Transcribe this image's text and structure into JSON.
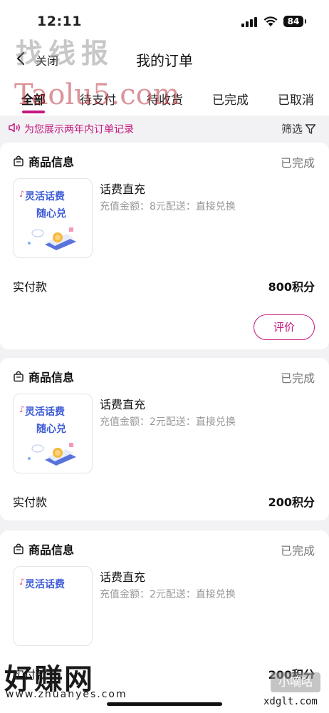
{
  "status_bar": {
    "time": "12:11",
    "battery": "84"
  },
  "nav": {
    "close_label": "关闭",
    "title": "我的订单"
  },
  "tabs": [
    {
      "label": "全部",
      "active": true
    },
    {
      "label": "待支付",
      "active": false
    },
    {
      "label": "待收货",
      "active": false
    },
    {
      "label": "已完成",
      "active": false
    },
    {
      "label": "已取消",
      "active": false
    }
  ],
  "notice": {
    "text": "为您展示两年内订单记录",
    "filter_label": "筛选"
  },
  "orders": [
    {
      "section_title": "商品信息",
      "status": "已完成",
      "thumb_line1": "灵活话费",
      "thumb_line2": "随心兑",
      "product_name": "话费直充",
      "product_desc": "充值金额：8元配送：直接兑换",
      "paid_label": "实付款",
      "paid_value": "800积分",
      "action_label": "评价"
    },
    {
      "section_title": "商品信息",
      "status": "已完成",
      "thumb_line1": "灵活话费",
      "thumb_line2": "随心兑",
      "product_name": "话费直充",
      "product_desc": "充值金额：2元配送：直接兑换",
      "paid_label": "实付款",
      "paid_value": "200积分"
    },
    {
      "section_title": "商品信息",
      "status": "已完成",
      "thumb_line1": "灵活话费",
      "product_name": "话费直充",
      "product_desc": "充值金额：2元配送：直接兑换",
      "paid_label": "实付款",
      "paid_value": "200积分"
    }
  ],
  "watermarks": {
    "top_cn": "找线报",
    "top_en": "Taolu5.com",
    "bottom_cn": "好赚网",
    "bottom_url": "www.zhuanyes.com",
    "bottom_right_cn": "小嘀咕",
    "bottom_right_url": "xdglt.com"
  },
  "colors": {
    "accent": "#c4187e",
    "background": "#f2f2f4"
  }
}
